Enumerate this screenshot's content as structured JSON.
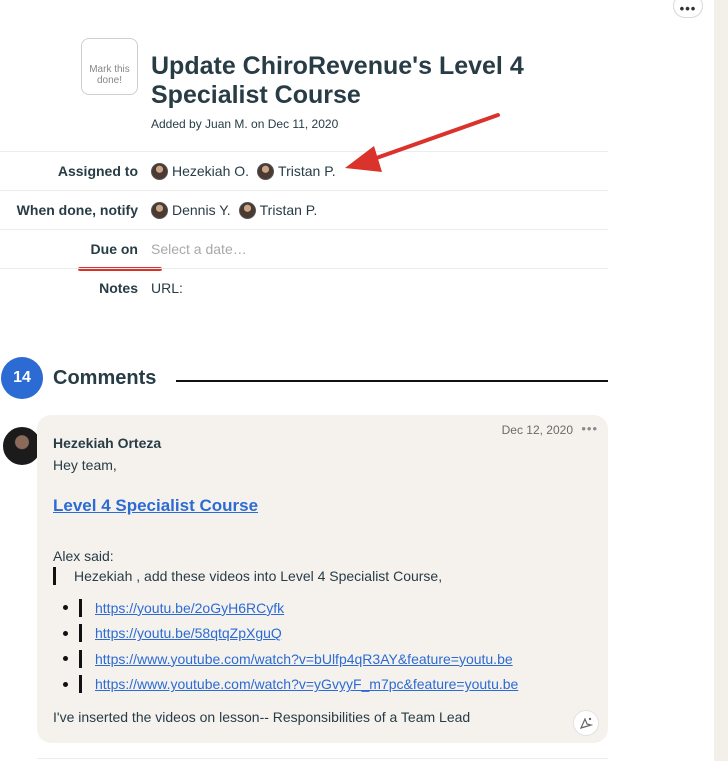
{
  "top_more_label": "•••",
  "todo": {
    "done_button": "Mark this done!",
    "title": "Update ChiroRevenue's Level 4 Specialist Course",
    "added_by": "Added by Juan M. on Dec 11, 2020"
  },
  "fields": {
    "assigned_to": {
      "label": "Assigned to",
      "people": [
        "Hezekiah O.",
        "Tristan P."
      ]
    },
    "notify": {
      "label": "When done, notify",
      "people": [
        "Dennis Y.",
        "Tristan P."
      ]
    },
    "due_on": {
      "label": "Due on",
      "placeholder": "Select a date…"
    },
    "notes": {
      "label": "Notes",
      "value": "URL:"
    }
  },
  "comments": {
    "count": "14",
    "title": "Comments",
    "items": [
      {
        "author": "Hezekiah Orteza",
        "date": "Dec 12, 2020",
        "more": "•••",
        "greeting": "Hey team,",
        "heading_link": "Level 4 Specialist Course",
        "said": "Alex said:",
        "quote": "Hezekiah , add these videos into Level 4 Specialist Course,",
        "links": [
          "https://youtu.be/2oGyH6RCyfk",
          "https://youtu.be/58qtqZpXguQ",
          "https://www.youtube.com/watch?v=bUlfp4qR3AY&feature=youtu.be",
          "https://www.youtube.com/watch?v=yGvyyF_m7pc&feature=youtu.be"
        ],
        "closing": "I've inserted the videos on lesson-- Responsibilities of a Team Lead"
      }
    ]
  },
  "colors": {
    "accent_blue": "#2c6bd3",
    "annotation_red": "#d9332b",
    "text_dark": "#283c46",
    "comment_bg": "#f5f2ee"
  },
  "icons": [
    "more-icon",
    "boost-icon",
    "annotation-arrow"
  ]
}
